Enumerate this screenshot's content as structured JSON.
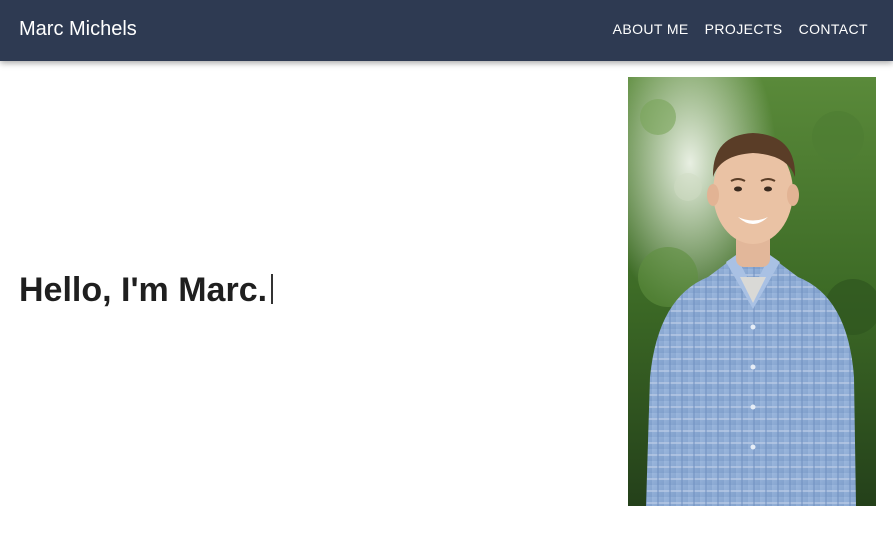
{
  "header": {
    "brand": "Marc Michels",
    "nav": [
      {
        "label": "ABOUT ME"
      },
      {
        "label": "PROJECTS"
      },
      {
        "label": "CONTACT"
      }
    ]
  },
  "hero": {
    "greeting": "Hello, I'm Marc."
  },
  "colors": {
    "navbar": "#2e3a52",
    "nav_text": "#ffffff",
    "body_text": "#1f1f1f"
  }
}
